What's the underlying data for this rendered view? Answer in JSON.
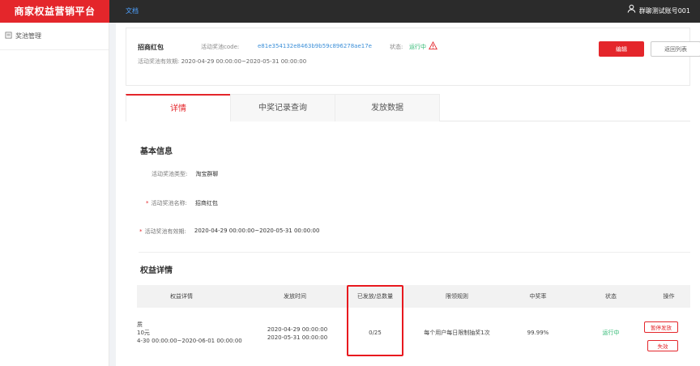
{
  "header": {
    "brand": "商家权益营销平台",
    "doc_link": "文档",
    "user_name": "群聊测试账号001",
    "user_icon": "user-icon"
  },
  "sidebar": {
    "items": [
      {
        "label": "奖池管理",
        "icon": "document-icon"
      }
    ]
  },
  "pool": {
    "name": "招商红包",
    "code_label": "活动奖池code:",
    "code": "e81e354132e8463b9b59c896278ae17e",
    "status_label": "状态:",
    "status": "运行中",
    "status_icon": "warning-icon",
    "period_label": "活动奖池有效期:",
    "period": "2020-04-29 00:00:00~2020-05-31 00:00:00",
    "edit_label": "编辑",
    "back_label": "返回列表"
  },
  "tabs": [
    {
      "label": "详情",
      "active": true
    },
    {
      "label": "中奖记录查询",
      "active": false
    },
    {
      "label": "发放数据",
      "active": false
    }
  ],
  "basic_info": {
    "title": "基本信息",
    "fields": [
      {
        "label": "活动奖池类型:",
        "value": "淘宝群聊",
        "required": false
      },
      {
        "label": "活动奖池名称:",
        "value": "招商红包",
        "required": true
      },
      {
        "label": "活动奖池有效期:",
        "value": "2020-04-29 00:00:00~2020-05-31 00:00:00",
        "required": true
      }
    ]
  },
  "rights": {
    "title": "权益详情",
    "columns": [
      "权益详情",
      "发放时间",
      "已发放/总数量",
      "限领规则",
      "中奖率",
      "状态",
      "操作"
    ],
    "rows": [
      {
        "detail_line1": "质",
        "detail_line2": "10元",
        "detail_line3": "4-30 00:00:00~2020-06-01 00:00:00",
        "time_start": "2020-04-29 00:00:00",
        "time_end": "2020-05-31 00:00:00",
        "issued": "0/25",
        "rule": "每个用户每日限制抽奖1次",
        "rate": "99.99%",
        "status": "运行中",
        "action_pause": "暂停发放",
        "action_invalid": "失效"
      }
    ]
  },
  "colors": {
    "brand": "#e4262b",
    "topbar": "#2b2b2b",
    "link": "#3b8fd8",
    "success": "#2eb872",
    "highlight": "#e8191f"
  }
}
